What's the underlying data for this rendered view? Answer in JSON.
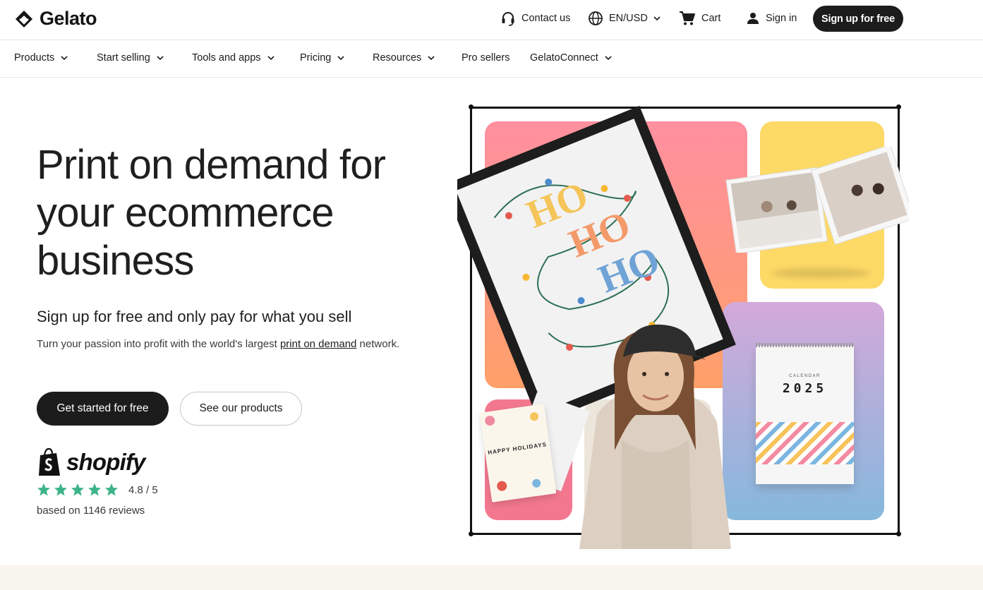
{
  "brand": {
    "name": "Gelato"
  },
  "utility": {
    "contact": "Contact us",
    "locale": "EN/USD",
    "cart": "Cart",
    "signin": "Sign in",
    "signup": "Sign up for free"
  },
  "nav": [
    {
      "label": "Products",
      "dropdown": true
    },
    {
      "label": "Start selling",
      "dropdown": true
    },
    {
      "label": "Tools and apps",
      "dropdown": true
    },
    {
      "label": "Pricing",
      "dropdown": true
    },
    {
      "label": "Resources",
      "dropdown": true
    },
    {
      "label": "Pro sellers",
      "dropdown": false
    },
    {
      "label": "GelatoConnect",
      "dropdown": true
    }
  ],
  "hero": {
    "title": "Print on demand for your ecommerce business",
    "subtitle": "Sign up for free and only pay for what you sell",
    "desc_prefix": "Turn your passion into profit with the world's largest ",
    "desc_link": "print on demand",
    "desc_suffix": " network.",
    "cta_primary": "Get started for free",
    "cta_secondary": "See our products"
  },
  "shopify": {
    "name": "shopify",
    "rating": "4.8 / 5",
    "stars": 5,
    "reviews": "based on 1146 reviews"
  },
  "collage": {
    "poster_text": "HO HO HO",
    "calendar_label": "CALENDAR",
    "calendar_year": "2025",
    "card_text": "HAPPY HOLIDAYS"
  },
  "colors": {
    "dark": "#1c1c1c",
    "star": "#3db488",
    "pink_panel": "#ff8f8f",
    "yellow_panel": "#fdd966",
    "lilac_panel": "#c9a9dc",
    "footer_strip": "#f8f4ee"
  }
}
